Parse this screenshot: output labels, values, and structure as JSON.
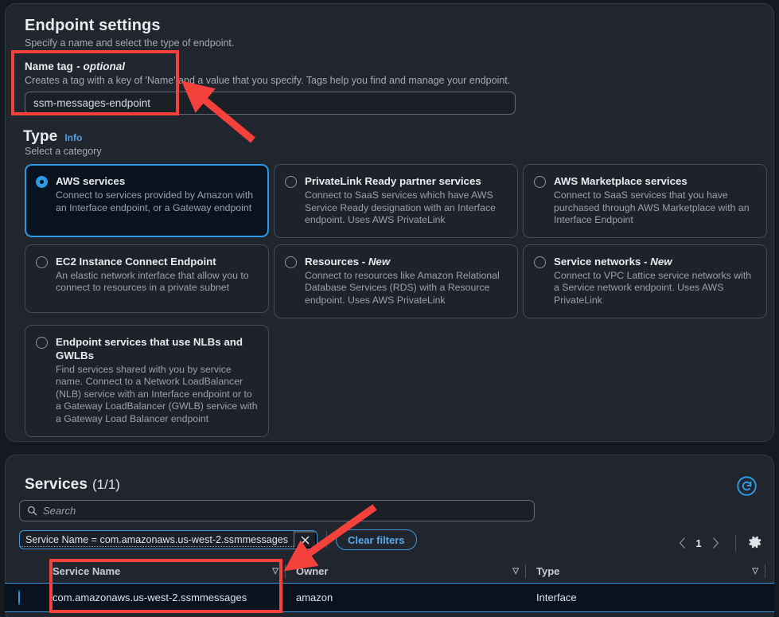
{
  "endpoint_settings": {
    "title": "Endpoint settings",
    "description": "Specify a name and select the type of endpoint.",
    "name_tag": {
      "label": "Name tag",
      "optional_suffix": "- optional",
      "description": "Creates a tag with a key of 'Name' and a value that you specify. Tags help you find and manage your endpoint.",
      "value": "ssm-messages-endpoint"
    },
    "type": {
      "heading": "Type",
      "info_link": "Info",
      "description": "Select a category",
      "options": [
        {
          "title": "AWS services",
          "description": "Connect to services provided by Amazon with an Interface endpoint, or a Gateway endpoint",
          "selected": true
        },
        {
          "title": "PrivateLink Ready partner services",
          "description": "Connect to SaaS services which have AWS Service Ready designation with an Interface endpoint. Uses AWS PrivateLink",
          "selected": false
        },
        {
          "title": "AWS Marketplace services",
          "description": "Connect to SaaS services that you have purchased through AWS Marketplace with an Interface Endpoint",
          "selected": false
        },
        {
          "title": "EC2 Instance Connect Endpoint",
          "description": "An elastic network interface that allow you to connect to resources in a private subnet",
          "selected": false
        },
        {
          "title": "Resources - New",
          "description": "Connect to resources like Amazon Relational Database Services (RDS) with a Resource endpoint. Uses AWS PrivateLink",
          "selected": false
        },
        {
          "title": "Service networks - New",
          "description": "Connect to VPC Lattice service networks with a Service network endpoint. Uses AWS PrivateLink",
          "selected": false
        },
        {
          "title": "Endpoint services that use NLBs and GWLBs",
          "description": "Find services shared with you by service name. Connect to a Network LoadBalancer (NLB) service with an Interface endpoint or to a Gateway LoadBalancer (GWLB) service with a Gateway Load Balancer endpoint",
          "selected": false
        }
      ]
    }
  },
  "services": {
    "title": "Services",
    "count": "(1/1)",
    "refresh_icon": "refresh-icon",
    "search": {
      "placeholder": "Search",
      "value": "",
      "icon": "search-icon"
    },
    "filter_token": {
      "text": "Service Name = com.amazonaws.us-west-2.ssmmessages",
      "remove_icon": "close-icon"
    },
    "clear_filters_label": "Clear filters",
    "pagination": {
      "prev_icon": "chevron-left-icon",
      "page": "1",
      "next_icon": "chevron-right-icon",
      "settings_icon": "gear-icon"
    },
    "table": {
      "columns": [
        "Service Name",
        "Owner",
        "Type"
      ],
      "rows": [
        {
          "selected": true,
          "service_name": "com.amazonaws.us-west-2.ssmmessages",
          "owner": "amazon",
          "type": "Interface"
        }
      ]
    }
  },
  "annotations": {
    "color": "#f4413c",
    "boxes": [
      "name-tag-field",
      "service-name-column"
    ],
    "arrows": [
      "arrow-to-name-tag-field",
      "arrow-to-service-name-column"
    ]
  }
}
